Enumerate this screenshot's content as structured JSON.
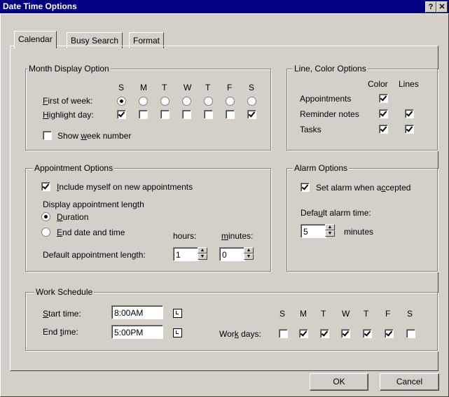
{
  "window": {
    "title": "Date Time Options",
    "help_glyph": "?",
    "close_glyph": "✕"
  },
  "tabs": [
    "Calendar",
    "Busy Search",
    "Format"
  ],
  "month_display": {
    "legend": "Month Display Option",
    "day_headers": [
      "S",
      "M",
      "T",
      "W",
      "T",
      "F",
      "S"
    ],
    "first_of_week_label": "First of week:",
    "first_of_week_selected": 0,
    "highlight_day_label": "Highlight day:",
    "highlight_days": [
      true,
      false,
      false,
      false,
      false,
      false,
      true
    ],
    "show_week_number_label": "Show week number",
    "show_week_number": false
  },
  "line_color": {
    "legend": "Line, Color Options",
    "col_color": "Color",
    "col_lines": "Lines",
    "rows": [
      {
        "label": "Appointments",
        "color": true,
        "lines": null
      },
      {
        "label": "Reminder notes",
        "color": true,
        "lines": true
      },
      {
        "label": "Tasks",
        "color": true,
        "lines": true
      }
    ]
  },
  "appointment": {
    "legend": "Appointment Options",
    "include_myself_label": "Include myself on new appointments",
    "include_myself": true,
    "display_length_label": "Display appointment length",
    "duration_label": "Duration",
    "end_date_label": "End date and time",
    "selected": "duration",
    "hours_label": "hours:",
    "minutes_label": "minutes:",
    "default_length_label": "Default appointment length:",
    "hours_value": "1",
    "minutes_value": "0"
  },
  "alarm": {
    "legend": "Alarm Options",
    "set_alarm_label": "Set alarm when accepted",
    "set_alarm": true,
    "default_time_label": "Default alarm time:",
    "value": "5",
    "unit": "minutes"
  },
  "work": {
    "legend": "Work Schedule",
    "start_label": "Start time:",
    "start_value": "8:00AM",
    "end_label": "End time:",
    "end_value": "5:00PM",
    "days_label": "Work days:",
    "day_headers": [
      "S",
      "M",
      "T",
      "W",
      "T",
      "F",
      "S"
    ],
    "days": [
      false,
      true,
      true,
      true,
      true,
      true,
      false
    ]
  },
  "buttons": {
    "ok": "OK",
    "cancel": "Cancel"
  }
}
